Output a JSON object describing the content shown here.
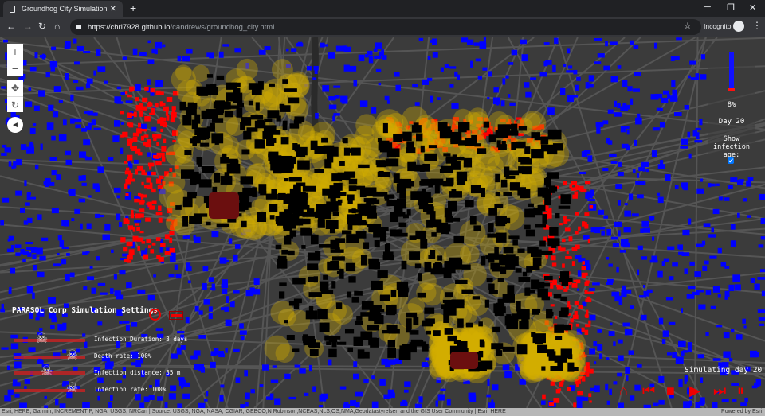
{
  "browser": {
    "tab_title": "Groundhog City Simulation",
    "new_tab": "+",
    "url_host": "https://chri7928.github.io",
    "url_path": "/candrews/groundhog_city.html",
    "incognito": "Incognito"
  },
  "map_controls": {
    "zoom_in": "+",
    "zoom_out": "−",
    "pan": "✥",
    "rotate": "↻",
    "compass": "◄"
  },
  "status_panel": {
    "percent": "8%",
    "percent_value": 0.08,
    "day": "Day 20",
    "show_age_label": "Show infection age:",
    "show_age_checked": true
  },
  "settings": {
    "title": "PARASOL Corp Simulation Settings",
    "help": "?",
    "sliders": [
      {
        "label": "Infection Duration: 3 days"
      },
      {
        "label": "Death rate: 100%"
      },
      {
        "label": "Infection distance: 35 m"
      },
      {
        "label": "Infection rate: 100%"
      }
    ]
  },
  "playback": {
    "status": "Simulating day 20",
    "buttons": [
      "home",
      "skip-back",
      "stop",
      "play",
      "step-forward",
      "pause"
    ]
  },
  "attribution": {
    "text": "Esri, HERE, Garmin, INCREMENT P, NGA, USGS, NRCan | Source: USGS, NGA, NASA, CGIAR, GEBCO,N Robinson,NCEAS,NLS,OS,NMA,Geodatastyrelsen and the GIS User Community | Esri, HERE",
    "powered": "Powered by Esri"
  },
  "colors": {
    "healthy": "#0000ff",
    "infected": "#ff0000",
    "dead": "#000000",
    "zone": "#d4b000",
    "dark_infected": "#6b0f0f"
  }
}
